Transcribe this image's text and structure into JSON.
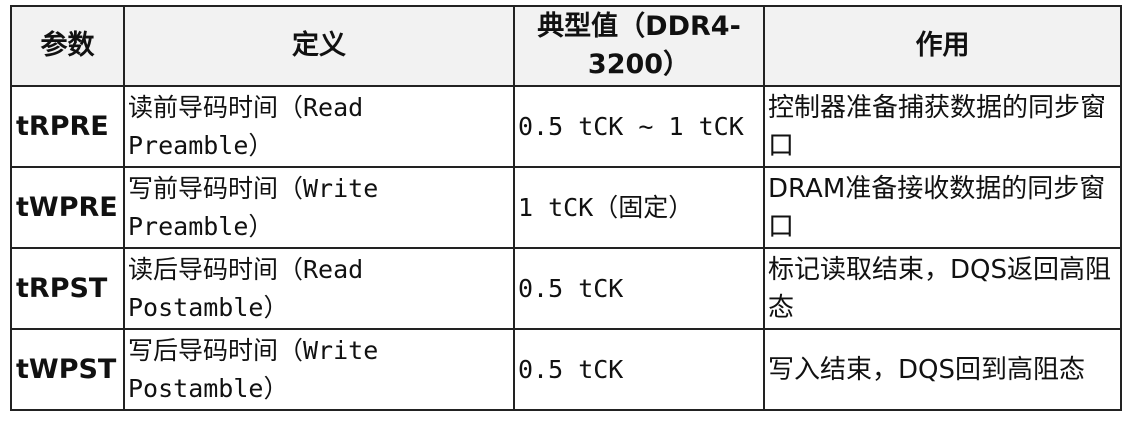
{
  "table": {
    "headers": [
      "参数",
      "定义",
      "典型值（DDR4-3200）",
      "作用"
    ],
    "rows": [
      {
        "param": "tRPRE",
        "definition": "读前导码时间（Read Preamble）",
        "value": "0.5 tCK ~ 1 tCK",
        "purpose": "控制器准备捕获数据的同步窗口"
      },
      {
        "param": "tWPRE",
        "definition": "写前导码时间（Write Preamble）",
        "value": "1 tCK（固定）",
        "purpose": "DRAM准备接收数据的同步窗口"
      },
      {
        "param": "tRPST",
        "definition": "读后导码时间（Read Postamble）",
        "value": "0.5 tCK",
        "purpose": "标记读取结束，DQS返回高阻态"
      },
      {
        "param": "tWPST",
        "definition": "写后导码时间（Write Postamble）",
        "value": "0.5 tCK",
        "purpose": "写入结束，DQS回到高阻态"
      }
    ]
  }
}
